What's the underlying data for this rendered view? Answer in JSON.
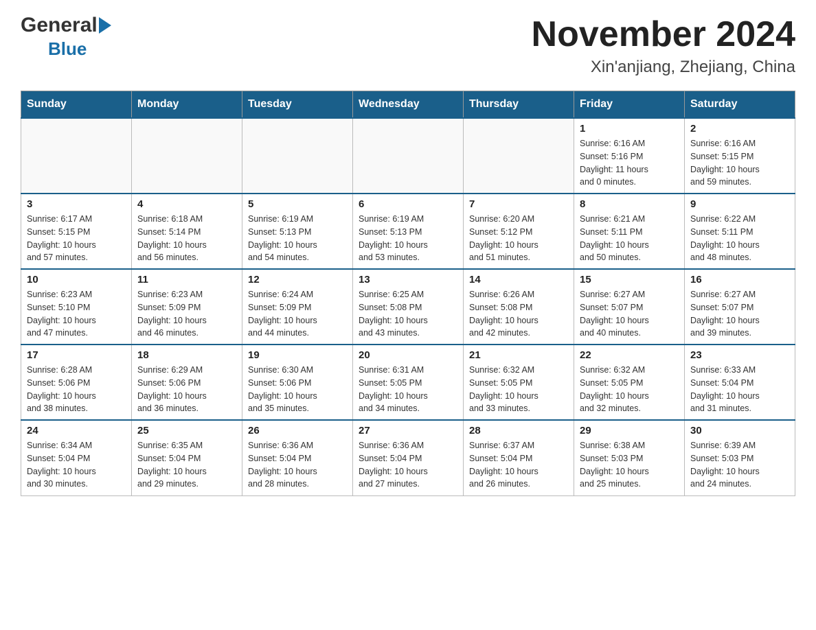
{
  "header": {
    "logo_general": "General",
    "logo_blue": "Blue",
    "month_title": "November 2024",
    "location": "Xin'anjiang, Zhejiang, China"
  },
  "weekdays": [
    "Sunday",
    "Monday",
    "Tuesday",
    "Wednesday",
    "Thursday",
    "Friday",
    "Saturday"
  ],
  "weeks": [
    [
      {
        "day": "",
        "info": ""
      },
      {
        "day": "",
        "info": ""
      },
      {
        "day": "",
        "info": ""
      },
      {
        "day": "",
        "info": ""
      },
      {
        "day": "",
        "info": ""
      },
      {
        "day": "1",
        "info": "Sunrise: 6:16 AM\nSunset: 5:16 PM\nDaylight: 11 hours\nand 0 minutes."
      },
      {
        "day": "2",
        "info": "Sunrise: 6:16 AM\nSunset: 5:15 PM\nDaylight: 10 hours\nand 59 minutes."
      }
    ],
    [
      {
        "day": "3",
        "info": "Sunrise: 6:17 AM\nSunset: 5:15 PM\nDaylight: 10 hours\nand 57 minutes."
      },
      {
        "day": "4",
        "info": "Sunrise: 6:18 AM\nSunset: 5:14 PM\nDaylight: 10 hours\nand 56 minutes."
      },
      {
        "day": "5",
        "info": "Sunrise: 6:19 AM\nSunset: 5:13 PM\nDaylight: 10 hours\nand 54 minutes."
      },
      {
        "day": "6",
        "info": "Sunrise: 6:19 AM\nSunset: 5:13 PM\nDaylight: 10 hours\nand 53 minutes."
      },
      {
        "day": "7",
        "info": "Sunrise: 6:20 AM\nSunset: 5:12 PM\nDaylight: 10 hours\nand 51 minutes."
      },
      {
        "day": "8",
        "info": "Sunrise: 6:21 AM\nSunset: 5:11 PM\nDaylight: 10 hours\nand 50 minutes."
      },
      {
        "day": "9",
        "info": "Sunrise: 6:22 AM\nSunset: 5:11 PM\nDaylight: 10 hours\nand 48 minutes."
      }
    ],
    [
      {
        "day": "10",
        "info": "Sunrise: 6:23 AM\nSunset: 5:10 PM\nDaylight: 10 hours\nand 47 minutes."
      },
      {
        "day": "11",
        "info": "Sunrise: 6:23 AM\nSunset: 5:09 PM\nDaylight: 10 hours\nand 46 minutes."
      },
      {
        "day": "12",
        "info": "Sunrise: 6:24 AM\nSunset: 5:09 PM\nDaylight: 10 hours\nand 44 minutes."
      },
      {
        "day": "13",
        "info": "Sunrise: 6:25 AM\nSunset: 5:08 PM\nDaylight: 10 hours\nand 43 minutes."
      },
      {
        "day": "14",
        "info": "Sunrise: 6:26 AM\nSunset: 5:08 PM\nDaylight: 10 hours\nand 42 minutes."
      },
      {
        "day": "15",
        "info": "Sunrise: 6:27 AM\nSunset: 5:07 PM\nDaylight: 10 hours\nand 40 minutes."
      },
      {
        "day": "16",
        "info": "Sunrise: 6:27 AM\nSunset: 5:07 PM\nDaylight: 10 hours\nand 39 minutes."
      }
    ],
    [
      {
        "day": "17",
        "info": "Sunrise: 6:28 AM\nSunset: 5:06 PM\nDaylight: 10 hours\nand 38 minutes."
      },
      {
        "day": "18",
        "info": "Sunrise: 6:29 AM\nSunset: 5:06 PM\nDaylight: 10 hours\nand 36 minutes."
      },
      {
        "day": "19",
        "info": "Sunrise: 6:30 AM\nSunset: 5:06 PM\nDaylight: 10 hours\nand 35 minutes."
      },
      {
        "day": "20",
        "info": "Sunrise: 6:31 AM\nSunset: 5:05 PM\nDaylight: 10 hours\nand 34 minutes."
      },
      {
        "day": "21",
        "info": "Sunrise: 6:32 AM\nSunset: 5:05 PM\nDaylight: 10 hours\nand 33 minutes."
      },
      {
        "day": "22",
        "info": "Sunrise: 6:32 AM\nSunset: 5:05 PM\nDaylight: 10 hours\nand 32 minutes."
      },
      {
        "day": "23",
        "info": "Sunrise: 6:33 AM\nSunset: 5:04 PM\nDaylight: 10 hours\nand 31 minutes."
      }
    ],
    [
      {
        "day": "24",
        "info": "Sunrise: 6:34 AM\nSunset: 5:04 PM\nDaylight: 10 hours\nand 30 minutes."
      },
      {
        "day": "25",
        "info": "Sunrise: 6:35 AM\nSunset: 5:04 PM\nDaylight: 10 hours\nand 29 minutes."
      },
      {
        "day": "26",
        "info": "Sunrise: 6:36 AM\nSunset: 5:04 PM\nDaylight: 10 hours\nand 28 minutes."
      },
      {
        "day": "27",
        "info": "Sunrise: 6:36 AM\nSunset: 5:04 PM\nDaylight: 10 hours\nand 27 minutes."
      },
      {
        "day": "28",
        "info": "Sunrise: 6:37 AM\nSunset: 5:04 PM\nDaylight: 10 hours\nand 26 minutes."
      },
      {
        "day": "29",
        "info": "Sunrise: 6:38 AM\nSunset: 5:03 PM\nDaylight: 10 hours\nand 25 minutes."
      },
      {
        "day": "30",
        "info": "Sunrise: 6:39 AM\nSunset: 5:03 PM\nDaylight: 10 hours\nand 24 minutes."
      }
    ]
  ]
}
